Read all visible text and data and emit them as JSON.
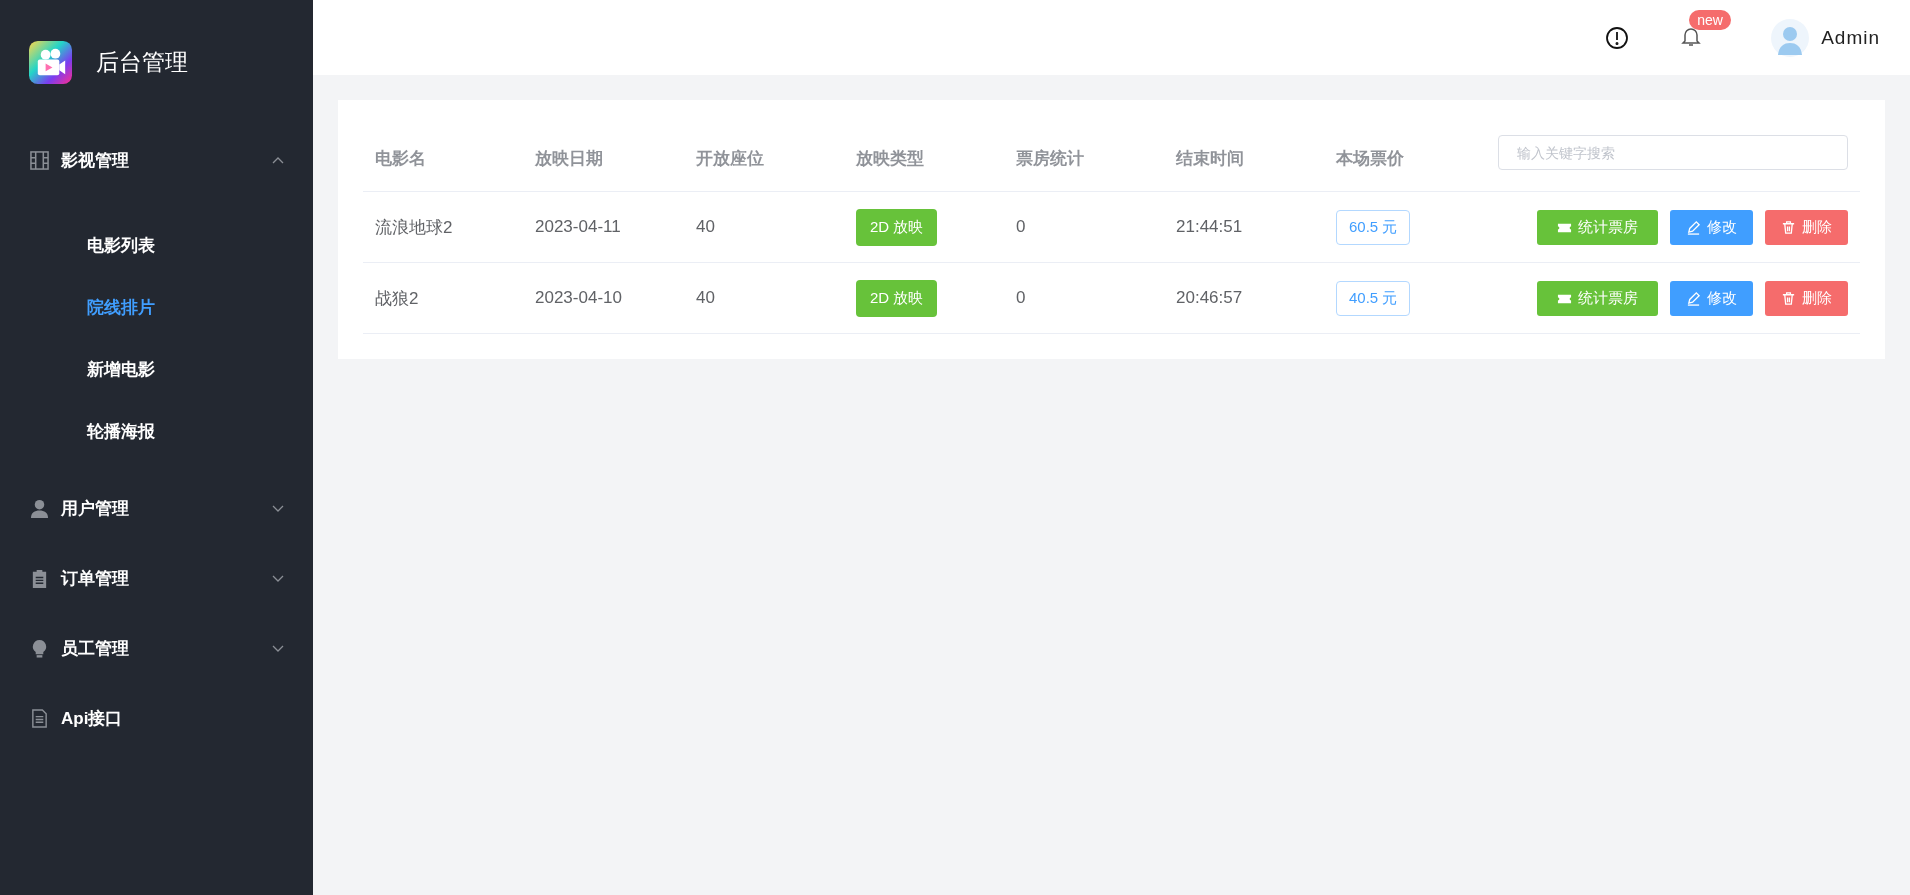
{
  "sidebar": {
    "title": "后台管理",
    "menu": [
      {
        "label": "影视管理",
        "kind": "film",
        "expanded": true,
        "children": [
          {
            "label": "电影列表",
            "selected": false
          },
          {
            "label": "院线排片",
            "selected": true
          },
          {
            "label": "新增电影",
            "selected": false
          },
          {
            "label": "轮播海报",
            "selected": false
          }
        ]
      },
      {
        "label": "用户管理",
        "kind": "user",
        "expanded": false
      },
      {
        "label": "订单管理",
        "kind": "clipboard",
        "expanded": false
      },
      {
        "label": "员工管理",
        "kind": "bulb",
        "expanded": false
      },
      {
        "label": "Api接口",
        "kind": "doc"
      }
    ]
  },
  "header": {
    "badge": "new",
    "user": "Admin"
  },
  "table": {
    "columns": [
      "电影名",
      "放映日期",
      "开放座位",
      "放映类型",
      "票房统计",
      "结束时间",
      "本场票价"
    ],
    "search": {
      "placeholder": "输入关键字搜索"
    },
    "rows": [
      {
        "name": "流浪地球2",
        "date": "2023-04-11",
        "seats": "40",
        "type": "2D 放映",
        "box_office": "0",
        "end_time": "21:44:51",
        "price": "60.5 元",
        "actions": [
          {
            "kind": "stats",
            "label": "统计票房"
          },
          {
            "kind": "edit",
            "label": "修改"
          },
          {
            "kind": "delete",
            "label": "删除"
          }
        ]
      },
      {
        "name": "战狼2",
        "date": "2023-04-10",
        "seats": "40",
        "type": "2D 放映",
        "box_office": "0",
        "end_time": "20:46:57",
        "price": "40.5 元",
        "actions": [
          {
            "kind": "stats",
            "label": "统计票房"
          },
          {
            "kind": "edit",
            "label": "修改"
          },
          {
            "kind": "delete",
            "label": "删除"
          }
        ]
      }
    ]
  }
}
